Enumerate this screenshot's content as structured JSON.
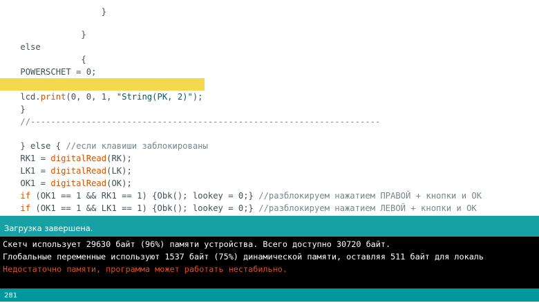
{
  "editor": {
    "lines": {
      "l0": {
        "a": "                ",
        "b": "}"
      },
      "l1": {
        "a": "            }"
      },
      "l2": {
        "a": "else"
      },
      "l3": {
        "a": "            {"
      },
      "l4": {
        "a": "POWERSCHET = 0;"
      },
      "l5": {
        "a": "            }"
      },
      "l6": {
        "a": "lcd.",
        "kw": "print",
        "b": "(0, 0, 1, ",
        "str": "\"String(PK, 2)\"",
        "c": ");"
      },
      "l7": {
        "a": "}"
      },
      "l8": {
        "cm": "//---------------------------------------------------------------------"
      },
      "l9": {
        "a": "} else { ",
        "cm": "//если клавиши заблокированы"
      },
      "l10": {
        "a": "RK1 = ",
        "kw": "digitalRead",
        "b": "(RK);"
      },
      "l11": {
        "a": "LK1 = ",
        "kw": "digitalRead",
        "b": "(LK);"
      },
      "l12": {
        "a": "OK1 = ",
        "kw": "digitalRead",
        "b": "(OK);"
      },
      "l13": {
        "kw": "if",
        "a": " (OK1 == 1 && RK1 == 1) {Obk(); lookey = 0;} ",
        "cm": "//разблокируем нажатием ПРАВОЙ + кнопки и ОК"
      },
      "l14": {
        "kw": "if",
        "a": " (OK1 == 1 && LK1 == 1) {Obk(); lookey = 0;} ",
        "cm": "//разблокируем нажатием ЛЕВОЙ + кнопки и ОК"
      }
    }
  },
  "status": {
    "text": "Загрузка завершена."
  },
  "console": {
    "line1": "Скетч использует 29630 байт (96%) памяти устройства. Всего доступно 30720 байт.",
    "line2": "Глобальные переменные используют 1537 байт (75%) динамической памяти, оставляя 511 байт для локаль",
    "line3": "Недостаточно памяти, программа может работать нестабильно."
  },
  "footer": {
    "line_number": "281"
  },
  "colors": {
    "keyword": "#d35400",
    "highlight": "#f5d94d",
    "status_bar": "#17a1a5",
    "error_text": "#e34c22"
  }
}
